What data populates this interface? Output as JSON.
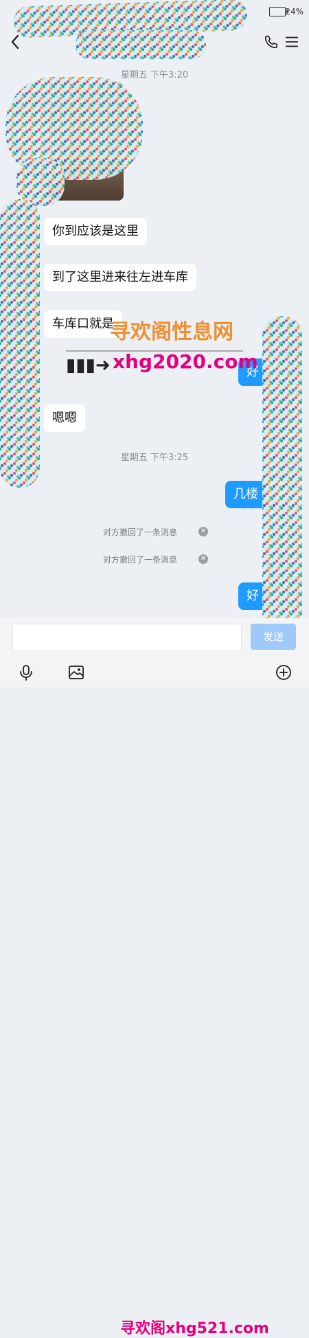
{
  "status_bar": {
    "battery": "24%"
  },
  "header": {
    "title": "",
    "subtitle": ""
  },
  "times": [
    "星期五 下午3:20",
    "星期五 下午3:25"
  ],
  "messages": {
    "m1": "你到应该是这里",
    "m2": "到了这里进来往左进车库",
    "m3": "车库口就是",
    "m4": "好",
    "m5": "嗯嗯",
    "m6": "几楼",
    "m7": "好"
  },
  "system": {
    "recall_1": "对方撤回了一条消息",
    "recall_2": "对方撤回了一条消息",
    "close_icon": "close-icon"
  },
  "watermarks": {
    "w1": "寻欢阁性息网",
    "w2": "xhg2020.com",
    "w3": "寻欢阁xhg521.com"
  },
  "composer": {
    "input_value": "",
    "send_label": "发送"
  },
  "icons": {
    "back": "chevron-left-icon",
    "phone": "phone-icon",
    "menu": "hamburger-icon",
    "voice": "microphone-icon",
    "image": "image-icon",
    "add": "plus-icon"
  },
  "colors": {
    "bubble_me": "#1e9bff",
    "send_disabled": "#9ec9f8",
    "background": "#eceff3"
  }
}
